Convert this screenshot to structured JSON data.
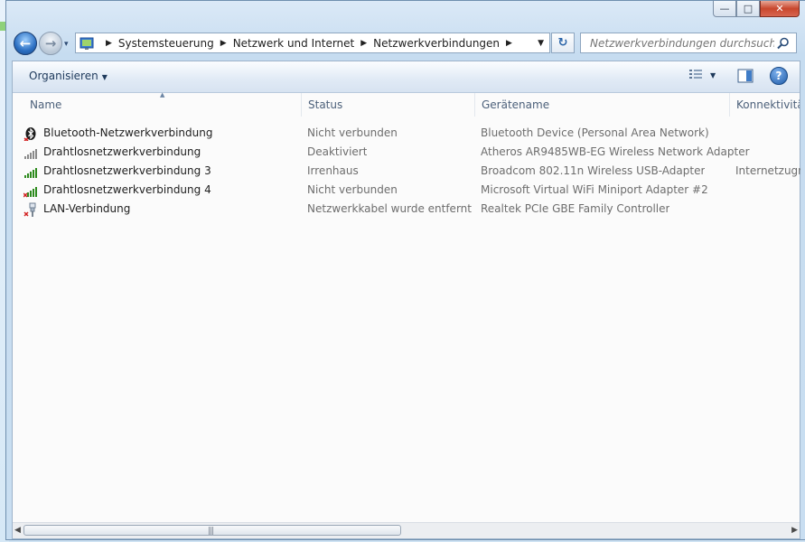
{
  "caption": {
    "minimize": "—",
    "maximize": "□",
    "close": "✕"
  },
  "nav": {
    "back_glyph": "←",
    "forward_glyph": "→",
    "history_glyph": "▾",
    "breadcrumbs": [
      "Systemsteuerung",
      "Netzwerk und Internet",
      "Netzwerkverbindungen"
    ],
    "crumb_separator": "▶",
    "address_dropdown_glyph": "▼",
    "refresh_glyph": "↻",
    "search_placeholder": "Netzwerkverbindungen durchsuchen"
  },
  "toolbar": {
    "organize_label": "Organisieren",
    "organize_caret": "▼",
    "view_caret": "▼",
    "help_glyph": "?"
  },
  "columns": [
    {
      "label": "Name"
    },
    {
      "label": "Status"
    },
    {
      "label": "Gerätename"
    },
    {
      "label": "Konnektivität"
    }
  ],
  "sort_arrow": "▲",
  "connections": [
    {
      "name": "Bluetooth-Netzwerkverbindung",
      "icon": "bluetooth-icon",
      "status": "Nicht verbunden",
      "device": "Bluetooth Device (Personal Area Network)",
      "connectivity": ""
    },
    {
      "name": "Drahtlosnetzwerkverbindung",
      "icon": "wireless-signal-gray-icon",
      "status": "Deaktiviert",
      "device": "Atheros AR9485WB-EG Wireless Network Adapter",
      "connectivity": ""
    },
    {
      "name": "Drahtlosnetzwerkverbindung 3",
      "icon": "wireless-signal-green-icon",
      "status": "Irrenhaus",
      "device": "Broadcom 802.11n Wireless USB-Adapter",
      "connectivity": "Internetzugriff"
    },
    {
      "name": "Drahtlosnetzwerkverbindung 4",
      "icon": "wireless-signal-green-x-icon",
      "status": "Nicht verbunden",
      "device": "Microsoft Virtual WiFi Miniport Adapter #2",
      "connectivity": ""
    },
    {
      "name": "LAN-Verbindung",
      "icon": "lan-cable-x-icon",
      "status": "Netzwerkkabel wurde entfernt",
      "device": "Realtek PCIe GBE Family Controller",
      "connectivity": ""
    }
  ],
  "scrollbar": {
    "left_arrow": "◀",
    "right_arrow": "▶",
    "grip": "|||"
  },
  "colors": {
    "accent": "#2b6fc2",
    "status_text": "#6d6d6d",
    "signal_green": "#2e8b1e"
  }
}
